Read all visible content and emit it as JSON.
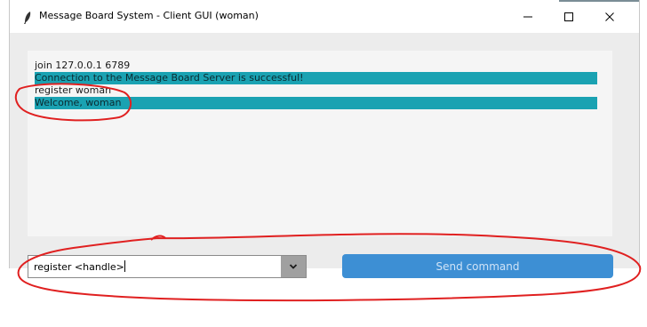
{
  "window": {
    "title": "Message Board System - Client GUI (woman)",
    "controls": {
      "minimize": "–",
      "maximize": "☐",
      "close": "✕"
    }
  },
  "log": {
    "lines": [
      {
        "text": "join 127.0.0.1 6789",
        "highlight": false
      },
      {
        "text": "Connection to the Message Board Server is successful!",
        "highlight": true
      },
      {
        "text": "register woman",
        "highlight": false
      },
      {
        "text": "Welcome, woman",
        "highlight": true
      }
    ],
    "highlight_color": "#1aa2b2"
  },
  "command": {
    "value": "register <handle>",
    "send_label": "Send command"
  },
  "colors": {
    "send_button": "#3d8fd4",
    "annotation": "#e02020"
  },
  "icons": {
    "app": "feather-icon",
    "dropdown": "chevron-down-icon"
  }
}
